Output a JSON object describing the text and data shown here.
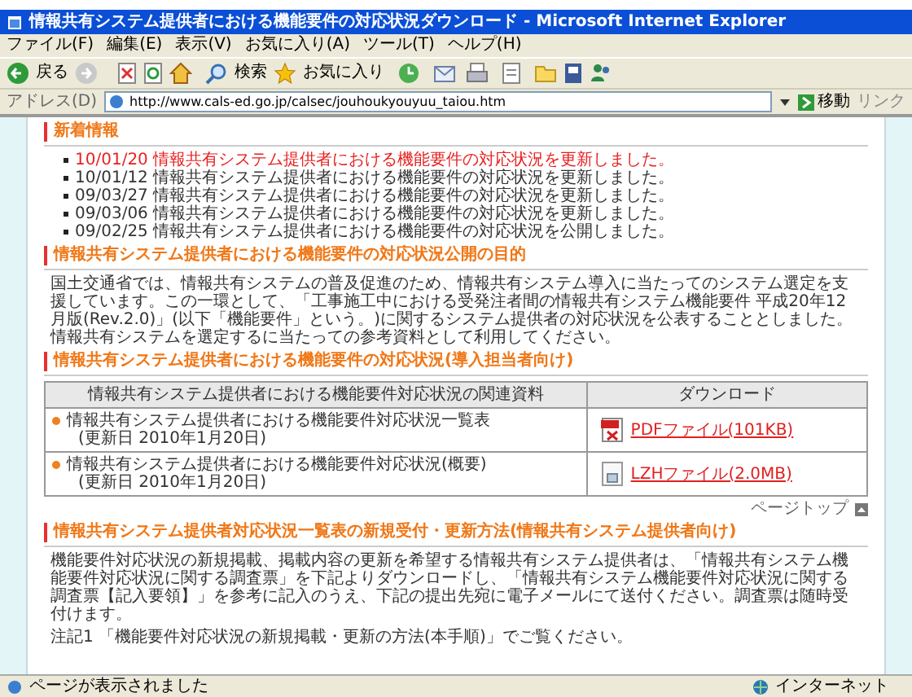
{
  "window": {
    "title": "情報共有システム提供者における機能要件の対応状況ダウンロード - Microsoft Internet Explorer"
  },
  "menu": [
    "ファイル(F)",
    "編集(E)",
    "表示(V)",
    "お気に入り(A)",
    "ツール(T)",
    "ヘルプ(H)"
  ],
  "toolbar": {
    "back": "戻る",
    "search": "検索",
    "favorites": "お気に入り"
  },
  "address": {
    "label": "アドレス(D)",
    "url": "http://www.cals-ed.go.jp/calsec/jouhoukyouyuu_taiou.htm",
    "go": "移動",
    "links": "リンク"
  },
  "news": {
    "heading": "新着情報",
    "items": [
      {
        "date": "10/01/20",
        "text": "情報共有システム提供者における機能要件の対応状況を更新しました。",
        "is_new": true
      },
      {
        "date": "10/01/12",
        "text": "情報共有システム提供者における機能要件の対応状況を更新しました。",
        "is_new": false
      },
      {
        "date": "09/03/27",
        "text": "情報共有システム提供者における機能要件の対応状況を更新しました。",
        "is_new": false
      },
      {
        "date": "09/03/06",
        "text": "情報共有システム提供者における機能要件の対応状況を更新しました。",
        "is_new": false
      },
      {
        "date": "09/02/25",
        "text": "情報共有システム提供者における機能要件の対応状況を公開しました。",
        "is_new": false
      }
    ]
  },
  "purpose": {
    "heading": "情報共有システム提供者における機能要件の対応状況公開の目的",
    "paragraph": "国土交通省では、情報共有システムの普及促進のため、情報共有システム導入に当たってのシステム選定を支援しています。この一環として、「工事施工中における受発注者間の情報共有システム機能要件 平成20年12月版(Rev.2.0)」(以下「機能要件」という。)に関するシステム提供者の対応状況を公表することとしました。情報共有システムを選定するに当たっての参考資料として利用してください。"
  },
  "downloads": {
    "heading": "情報共有システム提供者における機能要件の対応状況(導入担当者向け)",
    "columns": [
      "情報共有システム提供者における機能要件対応状況の関連資料",
      "ダウンロード"
    ],
    "rows": [
      {
        "title": "情報共有システム提供者における機能要件対応状況一覧表",
        "date": "(更新日 2010年1月20日)",
        "file": "PDFファイル(101KB)",
        "kind": "pdf"
      },
      {
        "title": "情報共有システム提供者における機能要件対応状況(概要)",
        "date": "(更新日 2010年1月20日)",
        "file": "LZHファイル(2.0MB)",
        "kind": "lzh"
      }
    ]
  },
  "page_top": "ページトップ",
  "registration": {
    "heading": "情報共有システム提供者対応状況一覧表の新規受付・更新方法(情報共有システム提供者向け)",
    "paragraph": "機能要件対応状況の新規掲載、掲載内容の更新を希望する情報共有システム提供者は、「情報共有システム機能要件対応状況に関する調査票」を下記よりダウンロードし、「情報共有システム機能要件対応状況に関する調査票【記入要領】」を参考に記入のうえ、下記の提出先宛に電子メールにて送付ください。調査票は随時受付けます。",
    "note": "注記1 「機能要件対応状況の新規掲載・更新の方法(本手順)」でご覧ください。"
  },
  "status": {
    "text": "ページが表示されました",
    "zone": "インターネット"
  }
}
